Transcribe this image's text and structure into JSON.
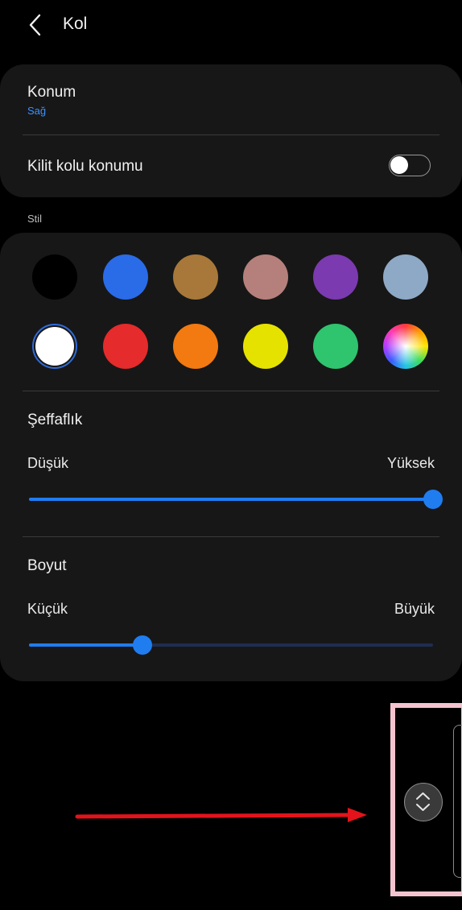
{
  "header": {
    "title": "Kol"
  },
  "konum": {
    "title": "Konum",
    "value": "Sağ"
  },
  "kilit": {
    "label": "Kilit kolu konumu",
    "enabled": false
  },
  "stil": {
    "section_label": "Stil"
  },
  "swatches": [
    {
      "name": "black",
      "color": "#000000"
    },
    {
      "name": "blue",
      "color": "#2a6be8"
    },
    {
      "name": "bronze",
      "color": "#a8783a"
    },
    {
      "name": "dusty-rose",
      "color": "#b5807b"
    },
    {
      "name": "purple",
      "color": "#7b3ab0"
    },
    {
      "name": "light-blue-gray",
      "color": "#8ea9c6"
    },
    {
      "name": "white",
      "color": "#ffffff",
      "selected": true
    },
    {
      "name": "red",
      "color": "#e52b2b"
    },
    {
      "name": "orange",
      "color": "#f27a10"
    },
    {
      "name": "yellow",
      "color": "#e6e200"
    },
    {
      "name": "green",
      "color": "#2fc46e"
    },
    {
      "name": "rainbow",
      "color": "conic-gradient"
    }
  ],
  "transparency": {
    "title": "Şeffaflık",
    "low": "Düşük",
    "high": "Yüksek",
    "value_percent": 100
  },
  "size": {
    "title": "Boyut",
    "low": "Küçük",
    "high": "Büyük",
    "value_percent": 28
  },
  "colors": {
    "accent": "#1f7df0",
    "card_bg": "#171717",
    "annotation_arrow": "#e3131b",
    "annotation_frame": "#f3c4cf"
  },
  "icons": {
    "back": "chevron-left-icon",
    "handle": "up-down-chevron-icon"
  }
}
